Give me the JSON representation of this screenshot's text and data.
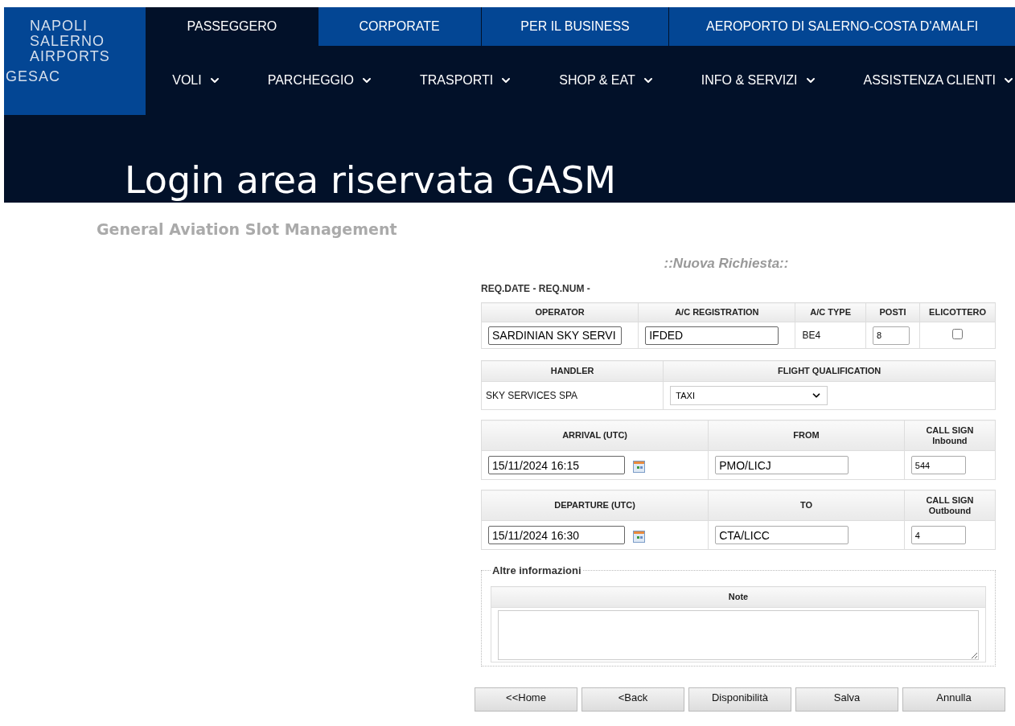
{
  "logo": {
    "lines": [
      "NAPOLI",
      "SALERNO",
      "AIRPORTS",
      "GESAC"
    ]
  },
  "top_tabs": [
    {
      "label": "PASSEGGERO",
      "selected": true
    },
    {
      "label": "CORPORATE",
      "selected": false
    },
    {
      "label": "PER IL BUSINESS",
      "selected": false
    },
    {
      "label": "AEROPORTO DI SALERNO-COSTA D'AMALFI",
      "selected": false
    }
  ],
  "main_menu": [
    {
      "label": "VOLI"
    },
    {
      "label": "PARCHEGGIO"
    },
    {
      "label": "TRASPORTI"
    },
    {
      "label": "SHOP & EAT"
    },
    {
      "label": "INFO & SERVIZI"
    },
    {
      "label": "ASSISTENZA CLIENTI"
    }
  ],
  "page_title": "Login area riservata GASM",
  "subtitle": "General Aviation Slot Management",
  "form": {
    "heading": "::Nuova Richiesta::",
    "req_info": "REQ.DATE - REQ.NUM -",
    "aircraft": {
      "columns": [
        "OPERATOR",
        "A/C REGISTRATION",
        "A/C TYPE",
        "POSTI",
        "ELICOTTERO"
      ],
      "operator": "SARDINIAN SKY SERVI",
      "registration": "IFDED",
      "type": "BE4",
      "posti": "8",
      "elicottero": false
    },
    "handling": {
      "columns": [
        "HANDLER",
        "FLIGHT QUALIFICATION"
      ],
      "handler": "SKY SERVICES SPA",
      "qualification": "TAXI"
    },
    "legs": [
      {
        "columns": [
          [
            "ARRIVAL (UTC)"
          ],
          [
            "FROM"
          ],
          [
            "CALL SIGN",
            "Inbound"
          ]
        ],
        "datetime": "15/11/2024 16:15",
        "airport": "PMO/LICJ",
        "call_sign": "544"
      },
      {
        "columns": [
          [
            "DEPARTURE (UTC)"
          ],
          [
            "TO"
          ],
          [
            "CALL SIGN",
            "Outbound"
          ]
        ],
        "datetime": "15/11/2024 16:30",
        "airport": "CTA/LICC",
        "call_sign": "4"
      }
    ],
    "other_info": {
      "legend": "Altre informazioni",
      "note_label": "Note"
    },
    "buttons": [
      "<<Home",
      "<Back",
      "Disponibilità",
      "Salva",
      "Annulla"
    ]
  }
}
